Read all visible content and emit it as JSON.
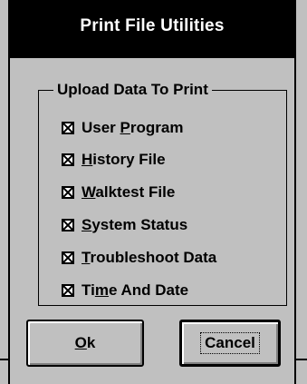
{
  "dialog": {
    "title": "Print File Utilities"
  },
  "group": {
    "label": "Upload Data To Print",
    "items": [
      {
        "pre": "User ",
        "key": "P",
        "post": "rogram",
        "checked": true
      },
      {
        "pre": "",
        "key": "H",
        "post": "istory File",
        "checked": true
      },
      {
        "pre": "",
        "key": "W",
        "post": "alktest File",
        "checked": true
      },
      {
        "pre": "",
        "key": "S",
        "post": "ystem Status",
        "checked": true
      },
      {
        "pre": "",
        "key": "T",
        "post": "roubleshoot Data",
        "checked": true
      },
      {
        "pre": "Ti",
        "key": "m",
        "post": "e And Date",
        "checked": true
      }
    ]
  },
  "buttons": {
    "ok": {
      "key": "O",
      "rest": "k"
    },
    "cancel": {
      "label": "Cancel"
    }
  },
  "colors": {
    "face": "#c0c0c0",
    "titlebar": "#000000",
    "title_text": "#ffffff"
  },
  "icons": {
    "checkmark": "x-check-icon"
  }
}
